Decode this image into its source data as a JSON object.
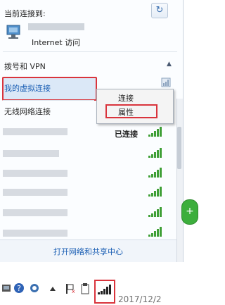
{
  "header": {
    "title": "当前连接到:",
    "refresh_icon": "↻"
  },
  "current_network": {
    "name_blurred": true,
    "access": "Internet 访问"
  },
  "vpn_section": {
    "title": "拨号和 VPN",
    "chevron": "▲"
  },
  "vpn_item": {
    "label": "我的虚拟连接"
  },
  "wireless_section": {
    "title": "无线网络连接"
  },
  "context_menu": {
    "connect": "连接",
    "properties": "属性"
  },
  "networks": [
    {
      "status": "已连接",
      "bars": 5
    },
    {
      "status": "",
      "bars": 5
    },
    {
      "status": "",
      "bars": 5
    },
    {
      "status": "",
      "bars": 5
    },
    {
      "status": "",
      "bars": 5
    },
    {
      "status": "",
      "bars": 5
    },
    {
      "status": "",
      "bars": 5
    }
  ],
  "footer": {
    "link": "打开网络和共享中心"
  },
  "taskbar": {
    "clock": "2017/12/2"
  },
  "colors": {
    "highlight": "#d9343c",
    "link": "#1b5fb4",
    "signal": "#3f9f36"
  }
}
